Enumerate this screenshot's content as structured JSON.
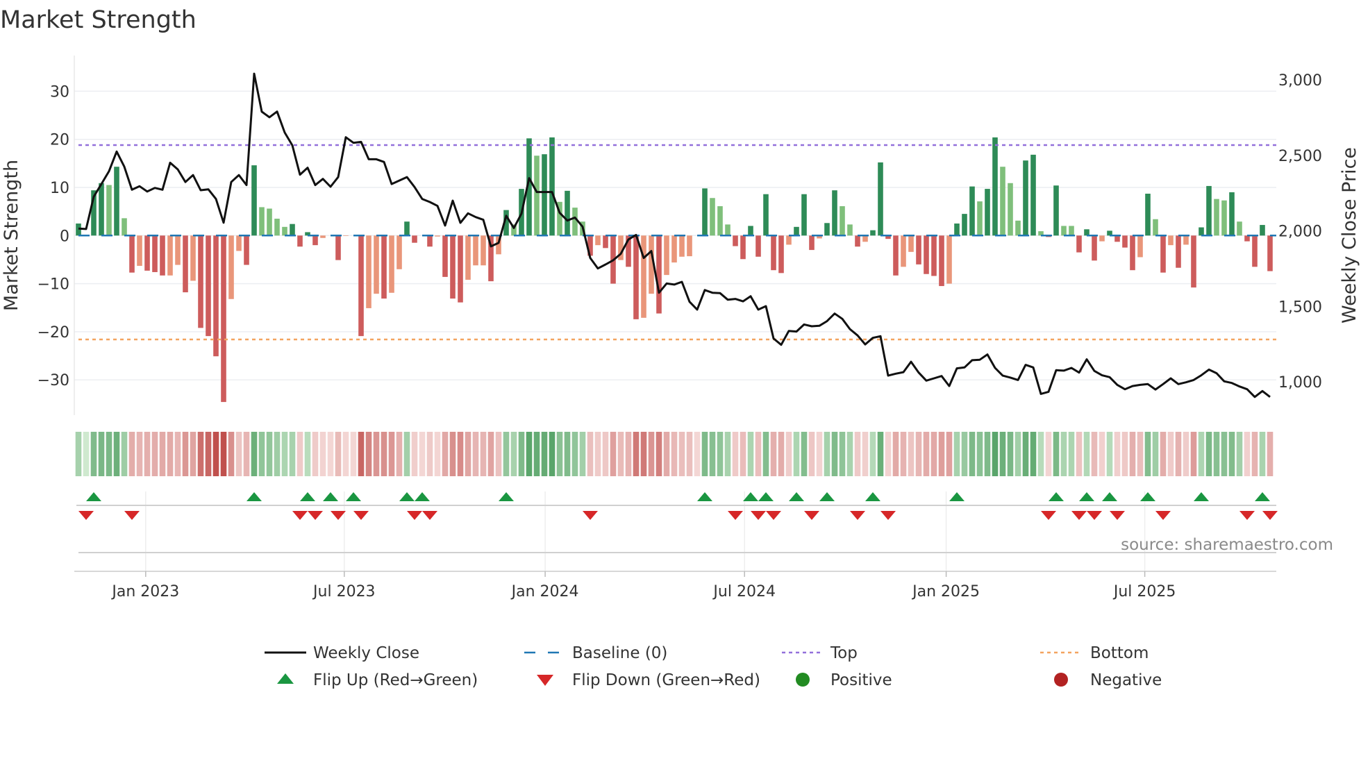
{
  "title": "Market Strength",
  "source": "source: sharemaestro.com",
  "colors": {
    "pos_strong": "#2e8b57",
    "pos_weak": "#7fbf7b",
    "neg_strong": "#cd5c5c",
    "neg_weak": "#e9967a",
    "baseline": "#1f77b4",
    "top": "#9370db",
    "bottom": "#f4a460",
    "close": "#111111",
    "flip_up": "#1a9641",
    "flip_down": "#d62728",
    "positive": "#228b22",
    "negative": "#b22222"
  },
  "legend": [
    {
      "label": "Weekly Close",
      "symbol": "line"
    },
    {
      "label": "Baseline (0)",
      "symbol": "dash"
    },
    {
      "label": "Top",
      "symbol": "dot-purple"
    },
    {
      "label": "Bottom",
      "symbol": "dot-orange"
    },
    {
      "label": "Flip Up (Red→Green)",
      "symbol": "triangle-up"
    },
    {
      "label": "Flip Down (Green→Red)",
      "symbol": "triangle-down"
    },
    {
      "label": "Positive",
      "symbol": "circle-green"
    },
    {
      "label": "Negative",
      "symbol": "circle-red"
    }
  ],
  "chart_data": {
    "type": "bar",
    "title": "Market Strength",
    "ylabel": "Market Strength",
    "y2label": "Weekly Close Price",
    "ylim": [
      -37,
      37
    ],
    "y2lim": [
      860,
      3250
    ],
    "yticks": [
      30,
      20,
      10,
      0,
      -10,
      -20,
      -30
    ],
    "ytick_labels": [
      "30",
      "20",
      "10",
      "0",
      "−10",
      "−20",
      "−30"
    ],
    "y2ticks": [
      3000,
      2500,
      2000,
      1500,
      1000
    ],
    "y2tick_labels": [
      "3,000",
      "2,500",
      "2,000",
      "1,500",
      "1,000"
    ],
    "xticks": [
      {
        "label": "Jan 2023",
        "week": 8.8
      },
      {
        "label": "Jul 2023",
        "week": 34.8
      },
      {
        "label": "Jan 2024",
        "week": 61.1
      },
      {
        "label": "Jul 2024",
        "week": 87.2
      },
      {
        "label": "Jan 2025",
        "week": 113.6
      },
      {
        "label": "Jul 2025",
        "week": 139.6
      }
    ],
    "top_level": 18.8,
    "bottom_level": -21.6,
    "baseline": 0,
    "strength": [
      2.5,
      0,
      9.4,
      10.9,
      10.5,
      14.3,
      3.6,
      -7.7,
      -6.3,
      -7.3,
      -7.6,
      -8.3,
      -8.3,
      -6.1,
      -11.8,
      -9.4,
      -19.2,
      -20.9,
      -25.1,
      -34.6,
      -13.2,
      -3.2,
      -6.1,
      14.6,
      5.9,
      5.6,
      3.5,
      1.8,
      2.4,
      -2.3,
      0.7,
      -2,
      -0.5,
      0,
      -5.1,
      -0.1,
      0,
      -20.9,
      -15.1,
      -12.1,
      -13.1,
      -11.9,
      -7,
      2.9,
      -1.5,
      0,
      -2.3,
      -0.2,
      -8.6,
      -13.1,
      -13.9,
      -9.2,
      -6.2,
      -6.2,
      -9.5,
      -3.9,
      5.3,
      2.3,
      9.7,
      20.2,
      16.6,
      16.9,
      20.4,
      7,
      9.3,
      5.8,
      2.9,
      -4.2,
      -2,
      -2.6,
      -10,
      -5.1,
      -6.5,
      -17.4,
      -17.1,
      -12.1,
      -16.2,
      -8.2,
      -5.6,
      -4.4,
      -4.3,
      0,
      9.8,
      7.8,
      6.1,
      2.3,
      -2.2,
      -4.9,
      2,
      -4.4,
      8.6,
      -7.2,
      -7.8,
      -1.9,
      1.8,
      8.6,
      -3,
      -0.6,
      2.6,
      9.4,
      6.1,
      2.3,
      -2.3,
      -1.3,
      1.1,
      15.2,
      -0.7,
      -8.3,
      -6.5,
      -3.4,
      -6,
      -8,
      -8.4,
      -10.5,
      -10,
      2.5,
      4.5,
      10.2,
      7.1,
      9.7,
      20.4,
      14.3,
      10.9,
      3.1,
      15.6,
      16.8,
      0.9,
      -0.3,
      10.4,
      2,
      2,
      -3.5,
      1.3,
      -5.2,
      -1.2,
      1,
      -1.3,
      -2.5,
      -7.2,
      -4.5,
      8.7,
      3.4,
      -7.7,
      -2,
      -6.7,
      -1.9,
      -10.8,
      1.7,
      10.3,
      7.6,
      7.3,
      9,
      2.9,
      -1.2,
      -6.5,
      2.2,
      -7.4
    ],
    "shade": [
      "S",
      "S",
      "S",
      "S",
      "W",
      "S",
      "W",
      "S",
      "W",
      "S",
      "S",
      "S",
      "W",
      "W",
      "S",
      "W",
      "S",
      "S",
      "S",
      "S",
      "W",
      "W",
      "S",
      "S",
      "W",
      "W",
      "W",
      "W",
      "S",
      "S",
      "S",
      "S",
      "W",
      "S",
      "S",
      "W",
      "S",
      "S",
      "W",
      "W",
      "S",
      "W",
      "W",
      "S",
      "S",
      "S",
      "S",
      "W",
      "S",
      "S",
      "S",
      "W",
      "W",
      "W",
      "S",
      "W",
      "S",
      "W",
      "S",
      "S",
      "W",
      "S",
      "S",
      "W",
      "S",
      "W",
      "W",
      "S",
      "W",
      "S",
      "S",
      "W",
      "S",
      "S",
      "W",
      "W",
      "S",
      "W",
      "W",
      "W",
      "W",
      "S",
      "S",
      "W",
      "W",
      "W",
      "S",
      "S",
      "S",
      "S",
      "S",
      "S",
      "S",
      "W",
      "S",
      "S",
      "S",
      "W",
      "S",
      "S",
      "W",
      "W",
      "S",
      "W",
      "S",
      "S",
      "S",
      "S",
      "W",
      "W",
      "S",
      "S",
      "S",
      "S",
      "W",
      "S",
      "S",
      "S",
      "W",
      "S",
      "S",
      "W",
      "W",
      "W",
      "S",
      "S",
      "W",
      "S",
      "S",
      "W",
      "W",
      "S",
      "S",
      "S",
      "W",
      "S",
      "S",
      "S",
      "S",
      "W",
      "S",
      "W",
      "S",
      "W",
      "S",
      "W",
      "S",
      "S",
      "S",
      "W",
      "W",
      "S",
      "W",
      "S",
      "S",
      "S",
      "S"
    ],
    "weekly_close": [
      2015,
      2012,
      2226,
      2310,
      2395,
      2525,
      2425,
      2272,
      2295,
      2260,
      2284,
      2272,
      2451,
      2407,
      2323,
      2369,
      2269,
      2275,
      2211,
      2054,
      2323,
      2369,
      2303,
      3041,
      2789,
      2752,
      2790,
      2651,
      2566,
      2372,
      2418,
      2303,
      2344,
      2292,
      2356,
      2620,
      2583,
      2589,
      2474,
      2474,
      2456,
      2310,
      2333,
      2356,
      2290,
      2211,
      2191,
      2165,
      2035,
      2200,
      2053,
      2116,
      2091,
      2073,
      1897,
      1920,
      2100,
      2019,
      2114,
      2349,
      2257,
      2257,
      2257,
      2119,
      2068,
      2088,
      2027,
      1820,
      1751,
      1777,
      1805,
      1848,
      1943,
      1973,
      1820,
      1866,
      1590,
      1651,
      1644,
      1662,
      1530,
      1478,
      1608,
      1590,
      1587,
      1544,
      1549,
      1533,
      1567,
      1478,
      1501,
      1287,
      1245,
      1337,
      1333,
      1380,
      1368,
      1371,
      1402,
      1452,
      1417,
      1349,
      1307,
      1248,
      1291,
      1302,
      1041,
      1054,
      1064,
      1133,
      1061,
      1008,
      1023,
      1038,
      972,
      1089,
      1095,
      1143,
      1146,
      1181,
      1092,
      1041,
      1028,
      1012,
      1112,
      1095,
      920,
      934,
      1077,
      1074,
      1092,
      1061,
      1149,
      1072,
      1043,
      1031,
      980,
      951,
      972,
      980,
      985,
      949,
      985,
      1023,
      985,
      997,
      1012,
      1043,
      1081,
      1057,
      1003,
      992,
      969,
      951,
      900,
      939,
      900
    ],
    "flip_up_weeks": [
      2,
      23,
      30,
      33,
      36,
      43,
      45,
      56,
      82,
      88,
      90,
      94,
      98,
      104,
      115,
      128,
      132,
      135,
      140,
      147,
      155
    ],
    "flip_down_weeks": [
      1,
      7,
      29,
      31,
      34,
      37,
      44,
      46,
      67,
      86,
      89,
      91,
      96,
      102,
      106,
      127,
      131,
      133,
      136,
      142,
      153,
      156
    ],
    "grid": true,
    "legend_position": "bottom"
  }
}
